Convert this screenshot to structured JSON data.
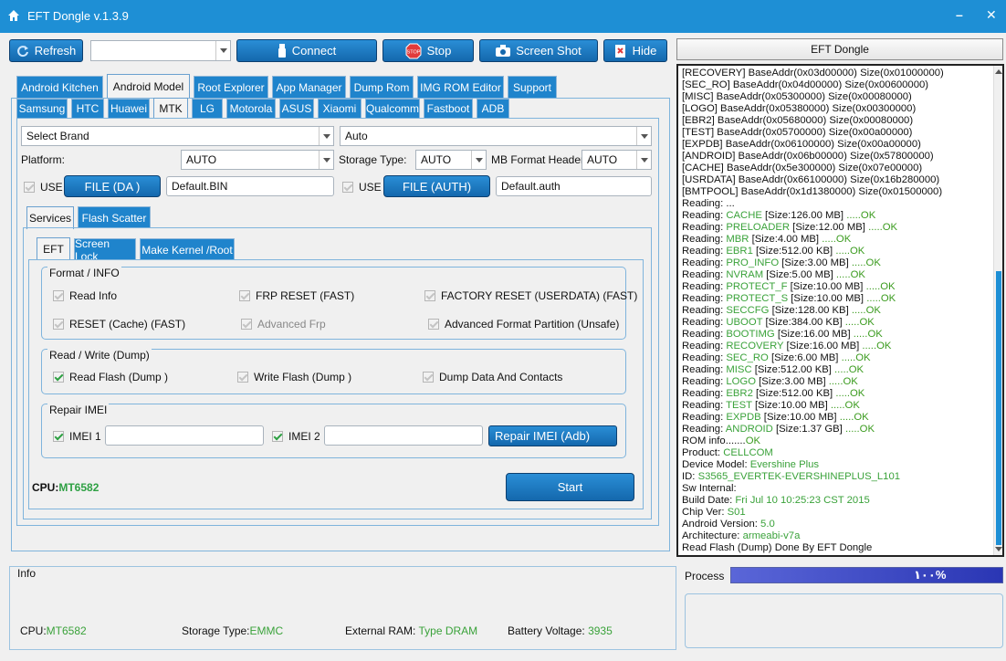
{
  "window": {
    "title": "EFT Dongle  v.1.3.9"
  },
  "toolbar": {
    "refresh": "Refresh",
    "connect": "Connect",
    "stop": "Stop",
    "stop_badge": "STOP",
    "screenshot": "Screen Shot",
    "hide": "Hide",
    "port_value": ""
  },
  "main_tabs": [
    "Android Kitchen",
    "Android Model",
    "Root Explorer",
    "App Manager",
    "Dump Rom",
    "IMG ROM Editor",
    "Support"
  ],
  "brand_tabs": [
    "Samsung",
    "HTC",
    "Huawei",
    "MTK",
    "LG",
    "Motorola",
    "ASUS",
    "Xiaomi",
    "Qualcomm",
    "Fastboot",
    "ADB"
  ],
  "mtk": {
    "brand_select": "Select Brand",
    "model_select": "Auto",
    "platform_label": "Platform:",
    "platform_value": "AUTO",
    "storage_label": "Storage Type:",
    "storage_value": "AUTO",
    "mbformat_label": "MB Format Header",
    "mbformat_value": "AUTO",
    "use_label": "USE",
    "file_da_btn": "FILE (DA )",
    "da_value": "Default.BIN",
    "file_auth_btn": "FILE (AUTH)",
    "auth_value": "Default.auth",
    "sub_tabs": [
      "Services",
      "Flash Scatter"
    ],
    "inner_tabs": [
      "EFT",
      "Screen Lock",
      "Make Kernel  /Root"
    ],
    "format_group": {
      "title": "Format / INFO",
      "read_info": "Read Info",
      "frp_reset": "FRP RESET (FAST)",
      "factory_reset": "FACTORY RESET (USERDATA) (FAST)",
      "reset_cache": "RESET (Cache) (FAST)",
      "advanced_frp": "Advanced Frp",
      "advanced_format": "Advanced Format Partition (Unsafe)"
    },
    "rw_group": {
      "title": "Read / Write (Dump)",
      "read_flash": "Read Flash (Dump )",
      "write_flash": "Write Flash (Dump )",
      "dump_data": "Dump Data And Contacts"
    },
    "imei_group": {
      "title": "Repair IMEI",
      "imei1": "IMEI 1",
      "imei1_value": "",
      "imei2": "IMEI 2",
      "imei2_value": "",
      "repair_btn": "Repair IMEI (Adb)"
    },
    "cpu_label": "CPU:",
    "cpu_value": "MT6582",
    "start_btn": "Start"
  },
  "info": {
    "title": "Info",
    "cpu_label": "CPU:",
    "cpu_value": "MT6582",
    "storage_label": "Storage Type:",
    "storage_value": "EMMC",
    "ram_label": "External RAM: ",
    "ram_value": "Type DRAM",
    "battery_label": "Battery Voltage: ",
    "battery_value": "3935"
  },
  "right_panel": {
    "header": "EFT Dongle",
    "process_label": "Process",
    "progress_text": "١٠٠%",
    "progress_fraction": 1.0
  },
  "log": [
    [
      [
        "[RECOVERY] BaseAddr(0x03d00000) Size(0x01000000)",
        ""
      ]
    ],
    [
      [
        "[SEC_RO] BaseAddr(0x04d00000) Size(0x00600000)",
        ""
      ]
    ],
    [
      [
        "[MISC] BaseAddr(0x05300000) Size(0x00080000)",
        ""
      ]
    ],
    [
      [
        "[LOGO] BaseAddr(0x05380000) Size(0x00300000)",
        ""
      ]
    ],
    [
      [
        "[EBR2] BaseAddr(0x05680000) Size(0x00080000)",
        ""
      ]
    ],
    [
      [
        "[TEST] BaseAddr(0x05700000) Size(0x00a00000)",
        ""
      ]
    ],
    [
      [
        "[EXPDB] BaseAddr(0x06100000) Size(0x00a00000)",
        ""
      ]
    ],
    [
      [
        "[ANDROID] BaseAddr(0x06b00000) Size(0x57800000)",
        ""
      ]
    ],
    [
      [
        "[CACHE] BaseAddr(0x5e300000) Size(0x07e00000)",
        ""
      ]
    ],
    [
      [
        "[USRDATA] BaseAddr(0x66100000) Size(0x16b280000)",
        ""
      ]
    ],
    [
      [
        "[BMTPOOL] BaseAddr(0x1d1380000) Size(0x01500000)",
        ""
      ]
    ],
    [
      [
        "Reading: ...",
        ""
      ]
    ],
    [
      [
        "Reading: ",
        ""
      ],
      [
        "CACHE",
        "g"
      ],
      [
        " [Size:126.00 MB] ",
        ""
      ],
      [
        ".....OK",
        "o"
      ]
    ],
    [
      [
        "Reading: ",
        ""
      ],
      [
        "PRELOADER",
        "g"
      ],
      [
        " [Size:12.00 MB] ",
        ""
      ],
      [
        ".....OK",
        "o"
      ]
    ],
    [
      [
        "Reading: ",
        ""
      ],
      [
        "MBR",
        "g"
      ],
      [
        " [Size:4.00 MB] ",
        ""
      ],
      [
        ".....OK",
        "o"
      ]
    ],
    [
      [
        "Reading: ",
        ""
      ],
      [
        "EBR1",
        "g"
      ],
      [
        " [Size:512.00 KB] ",
        ""
      ],
      [
        ".....OK",
        "o"
      ]
    ],
    [
      [
        "Reading: ",
        ""
      ],
      [
        "PRO_INFO",
        "g"
      ],
      [
        " [Size:3.00 MB] ",
        ""
      ],
      [
        ".....OK",
        "o"
      ]
    ],
    [
      [
        "Reading: ",
        ""
      ],
      [
        "NVRAM",
        "g"
      ],
      [
        " [Size:5.00 MB] ",
        ""
      ],
      [
        ".....OK",
        "o"
      ]
    ],
    [
      [
        "Reading: ",
        ""
      ],
      [
        "PROTECT_F",
        "g"
      ],
      [
        " [Size:10.00 MB] ",
        ""
      ],
      [
        ".....OK",
        "o"
      ]
    ],
    [
      [
        "Reading: ",
        ""
      ],
      [
        "PROTECT_S",
        "g"
      ],
      [
        " [Size:10.00 MB] ",
        ""
      ],
      [
        ".....OK",
        "o"
      ]
    ],
    [
      [
        "Reading: ",
        ""
      ],
      [
        "SECCFG",
        "g"
      ],
      [
        " [Size:128.00 KB] ",
        ""
      ],
      [
        ".....OK",
        "o"
      ]
    ],
    [
      [
        "Reading: ",
        ""
      ],
      [
        "UBOOT",
        "g"
      ],
      [
        " [Size:384.00 KB] ",
        ""
      ],
      [
        ".....OK",
        "o"
      ]
    ],
    [
      [
        "Reading: ",
        ""
      ],
      [
        "BOOTIMG",
        "g"
      ],
      [
        " [Size:16.00 MB] ",
        ""
      ],
      [
        ".....OK",
        "o"
      ]
    ],
    [
      [
        "Reading: ",
        ""
      ],
      [
        "RECOVERY",
        "g"
      ],
      [
        " [Size:16.00 MB] ",
        ""
      ],
      [
        ".....OK",
        "o"
      ]
    ],
    [
      [
        "Reading: ",
        ""
      ],
      [
        "SEC_RO",
        "g"
      ],
      [
        " [Size:6.00 MB] ",
        ""
      ],
      [
        ".....OK",
        "o"
      ]
    ],
    [
      [
        "Reading: ",
        ""
      ],
      [
        "MISC",
        "g"
      ],
      [
        " [Size:512.00 KB] ",
        ""
      ],
      [
        ".....OK",
        "o"
      ]
    ],
    [
      [
        "Reading: ",
        ""
      ],
      [
        "LOGO",
        "g"
      ],
      [
        " [Size:3.00 MB] ",
        ""
      ],
      [
        ".....OK",
        "o"
      ]
    ],
    [
      [
        "Reading: ",
        ""
      ],
      [
        "EBR2",
        "g"
      ],
      [
        " [Size:512.00 KB] ",
        ""
      ],
      [
        ".....OK",
        "o"
      ]
    ],
    [
      [
        "Reading: ",
        ""
      ],
      [
        "TEST",
        "g"
      ],
      [
        " [Size:10.00 MB] ",
        ""
      ],
      [
        ".....OK",
        "o"
      ]
    ],
    [
      [
        "Reading: ",
        ""
      ],
      [
        "EXPDB",
        "g"
      ],
      [
        " [Size:10.00 MB] ",
        ""
      ],
      [
        ".....OK",
        "o"
      ]
    ],
    [
      [
        "Reading: ",
        ""
      ],
      [
        "ANDROID",
        "g"
      ],
      [
        " [Size:1.37 GB] ",
        ""
      ],
      [
        ".....OK",
        "o"
      ]
    ],
    [
      [
        "ROM info.......",
        ""
      ],
      [
        "OK",
        "o"
      ]
    ],
    [
      [
        "Product: ",
        ""
      ],
      [
        "CELLCOM",
        "g"
      ]
    ],
    [
      [
        "Device Model: ",
        ""
      ],
      [
        "Evershine Plus",
        "g"
      ]
    ],
    [
      [
        "ID: ",
        ""
      ],
      [
        "S3565_EVERTEK-EVERSHINEPLUS_L101",
        "g"
      ]
    ],
    [
      [
        "Sw Internal:",
        ""
      ]
    ],
    [
      [
        "Build Date: ",
        ""
      ],
      [
        "Fri Jul 10 10:25:23 CST 2015",
        "g"
      ]
    ],
    [
      [
        "Chip Ver: ",
        ""
      ],
      [
        "S01",
        "g"
      ]
    ],
    [
      [
        "Android Version: ",
        ""
      ],
      [
        "5.0",
        "g"
      ]
    ],
    [
      [
        "Architecture: ",
        ""
      ],
      [
        "armeabi-v7a",
        "g"
      ]
    ],
    [
      [
        "Read Flash (Dump) Done By EFT Dongle",
        ""
      ]
    ]
  ]
}
